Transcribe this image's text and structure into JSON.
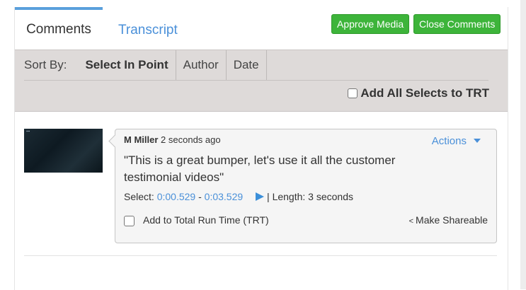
{
  "tabs": {
    "comments": "Comments",
    "transcript": "Transcript"
  },
  "buttons": {
    "approve": "Approve Media",
    "close": "Close Comments"
  },
  "sort": {
    "label": "Sort By:",
    "options": [
      "Select In Point",
      "Author",
      "Date"
    ],
    "add_all": "Add All Selects to TRT"
  },
  "comment": {
    "author": "M Miller",
    "time": "2 seconds ago",
    "actions": "Actions",
    "text": "\"This is a great bumper, let's use it all the customer testimonial videos\"",
    "select_label": "Select:",
    "in_point": "0:00.529",
    "separator": "-",
    "out_point": "0:03.529",
    "length": "| Length: 3 seconds",
    "trt_label": "Add to Total Run Time (TRT)",
    "share": "Make Shareable"
  },
  "colors": {
    "accent": "#4a90d9",
    "green": "#3db43a",
    "sortbar": "#dedad9"
  }
}
